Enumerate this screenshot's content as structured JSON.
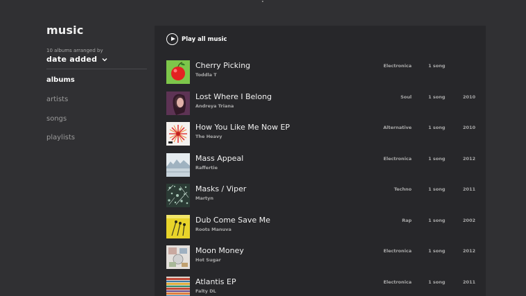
{
  "nav": {
    "title": "music",
    "arranged_caption": "10 albums arranged by",
    "sort_value": "date added",
    "sort_icon": "chevron-down-icon",
    "items": [
      {
        "label": "albums",
        "active": true
      },
      {
        "label": "artists",
        "active": false
      },
      {
        "label": "songs",
        "active": false
      },
      {
        "label": "playlists",
        "active": false
      }
    ]
  },
  "main": {
    "play_all_label": "Play all music",
    "play_icon": "play-circle-icon",
    "albums": [
      {
        "title": "Cherry Picking",
        "artist": "Toddla T",
        "genre": "Electronica",
        "count": "1 song",
        "year": "",
        "art": "cherry"
      },
      {
        "title": "Lost Where I Belong",
        "artist": "Andreya Triana",
        "genre": "Soul",
        "count": "1 song",
        "year": "2010",
        "art": "portrait"
      },
      {
        "title": "How You Like Me Now EP",
        "artist": "The Heavy",
        "genre": "Alternative",
        "count": "1 song",
        "year": "2010",
        "art": "burst"
      },
      {
        "title": "Mass Appeal",
        "artist": "Raffertie",
        "genre": "Electronica",
        "count": "1 song",
        "year": "2012",
        "art": "landscape"
      },
      {
        "title": "Masks / Viper",
        "artist": "Martyn",
        "genre": "Techno",
        "count": "1 song",
        "year": "2011",
        "art": "pattern"
      },
      {
        "title": "Dub Come Save Me",
        "artist": "Roots Manuva",
        "genre": "Rap",
        "count": "1 song",
        "year": "2002",
        "art": "yellow"
      },
      {
        "title": "Moon Money",
        "artist": "Hot Sugar",
        "genre": "Electronica",
        "count": "1 song",
        "year": "2012",
        "art": "collage"
      },
      {
        "title": "Atlantis EP",
        "artist": "Falty DL",
        "genre": "Electronica",
        "count": "1 song",
        "year": "2011",
        "art": "stripes"
      }
    ]
  },
  "colors": {
    "background": "#303033",
    "panel": "#27272a",
    "text_primary": "#f2f2f2",
    "text_secondary": "#a8a8a8"
  }
}
